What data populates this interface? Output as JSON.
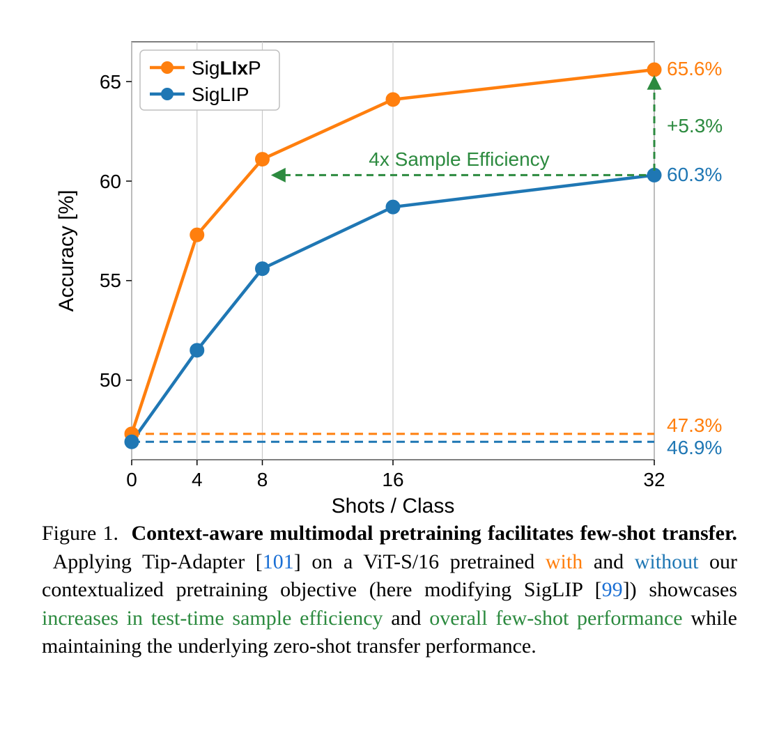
{
  "chart_data": {
    "type": "line",
    "xlabel": "Shots / Class",
    "ylabel": "Accuracy [%]",
    "x_ticks": [
      0,
      4,
      8,
      16,
      32
    ],
    "y_ticks": [
      50,
      55,
      60,
      65
    ],
    "ylim": [
      46,
      67
    ],
    "series": [
      {
        "name": "SigLIxP",
        "color": "#ff7f0e",
        "x": [
          0,
          4,
          8,
          16,
          32
        ],
        "y": [
          47.3,
          57.3,
          61.1,
          64.1,
          65.6
        ]
      },
      {
        "name": "SigLIP",
        "color": "#1f77b4",
        "x": [
          0,
          4,
          8,
          16,
          32
        ],
        "y": [
          46.9,
          51.5,
          55.6,
          58.7,
          60.3
        ]
      }
    ],
    "baselines": [
      {
        "name": "SigLIxP zero-shot",
        "y": 47.3,
        "color": "#ff7f0e",
        "label": "47.3%"
      },
      {
        "name": "SigLIP zero-shot",
        "y": 46.9,
        "color": "#1f77b4",
        "label": "46.9%"
      }
    ],
    "annotations": {
      "sample_efficiency": "4x Sample Efficiency",
      "gain": "+5.3%",
      "top_orange": "65.6%",
      "top_blue": "60.3%"
    },
    "legend": {
      "items": [
        "SigLIxP",
        "SigLIP"
      ],
      "position": "upper left"
    }
  },
  "caption": {
    "figure_label": "Figure 1.",
    "title_bold": "Context-aware multimodal pretraining facilitates few-shot transfer.",
    "pre_1": "Applying Tip-Adapter [",
    "cite_1": "101",
    "post_1": "] on a ViT-S/16 pretrained ",
    "with_word": "with",
    "and_word": " and ",
    "without_word": "without",
    "post_2": " our contextualized pretraining objective (here modifying SigLIP [",
    "cite_2": "99",
    "post_3": "]) showcases ",
    "green_1": "increases in test-time sample efficiency",
    "and2": " and ",
    "green_2": "overall few-shot performance",
    "tail": " while maintaining the underlying zero-shot transfer performance."
  }
}
